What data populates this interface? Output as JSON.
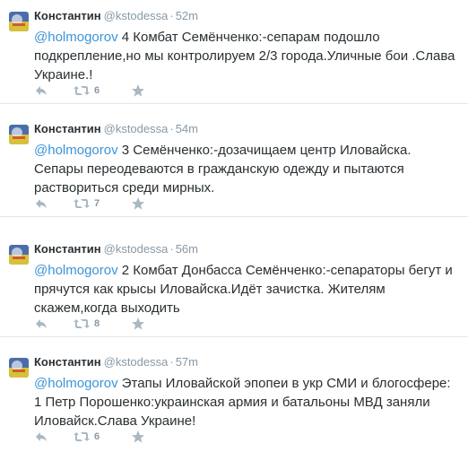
{
  "tweets": [
    {
      "fullname": "Константин",
      "username": "@kstodessa",
      "separator": "·",
      "time": "52m",
      "mention": "@holmogorov",
      "body": " 4 Комбат Семёнченко:-сепарам подошло подкрепление,но мы контролируем 2/3 города.Уличные бои .Слава Украине.!",
      "retweets": "6"
    },
    {
      "fullname": "Константин",
      "username": "@kstodessa",
      "separator": "·",
      "time": "54m",
      "mention": "@holmogorov",
      "body": " 3 Семёнченко:-дозачищаем центр Иловайска. Сепары переодеваются в гражданскую одежду и пытаются раствориться среди мирных.",
      "retweets": "7"
    },
    {
      "fullname": "Константин",
      "username": "@kstodessa",
      "separator": "·",
      "time": "56m",
      "mention": "@holmogorov",
      "body": " 2 Комбат Донбасса Семёнченко:-сепараторы бегут и прячутся как крысы  Иловайска.Идёт зачистка. Жителям скажем,когда выходить",
      "retweets": "8"
    },
    {
      "fullname": "Константин",
      "username": "@kstodessa",
      "separator": "·",
      "time": "57m",
      "mention": "@holmogorov",
      "body": " Этапы Иловайской эпопеи в укр СМИ и блогосфере: 1 Петр Порошенко:украинская армия и батальоны МВД заняли Иловайск.Слава Украине!",
      "retweets": "6"
    }
  ],
  "icons": {
    "reply": "reply-icon",
    "retweet": "retweet-icon",
    "favorite": "star-icon"
  },
  "colors": {
    "mention": "#3b94d9",
    "meta": "#8899a6",
    "icon": "#aab8c2"
  }
}
